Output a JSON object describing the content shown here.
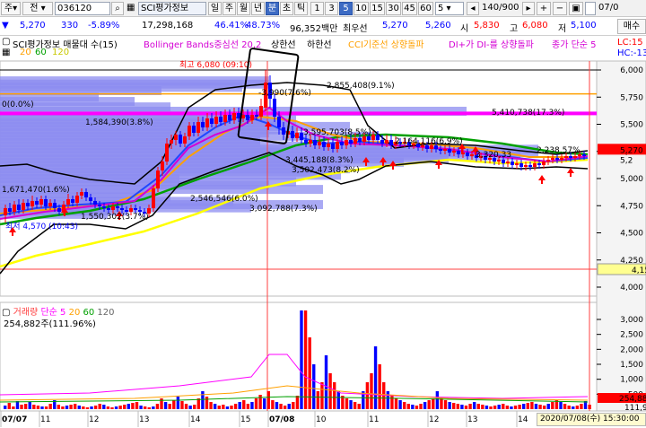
{
  "toolbar": {
    "menu_label": "주",
    "prev_label": "전",
    "stock_code": "036120",
    "stock_name": "SCI평가정보",
    "period_buttons": [
      "일",
      "주",
      "월",
      "년",
      "분",
      "초",
      "틱"
    ],
    "active_period": "분",
    "interval_buttons": [
      "1",
      "3",
      "5",
      "10",
      "15",
      "30",
      "45",
      "60"
    ],
    "active_interval": "5",
    "count_value": "5",
    "page_indicator": "140/900",
    "date_short": "07/0"
  },
  "price_info": {
    "price": "5,270",
    "change": "330",
    "change_rate": "-5.89%",
    "volume": "17,298,168",
    "rate_a": "46.41%",
    "rate_b": "48.73%",
    "trade_value": "96,352백만",
    "best_bid_label": "최우선",
    "ask": "5,270",
    "bid": "5,260",
    "open_label": "시",
    "open": "5,830",
    "high_label": "고",
    "high": "6,080",
    "low_label": "저",
    "low": "5,100"
  },
  "legend": {
    "main_series": "SCI평가정보 매물대 수(15)",
    "bollinger": "Bollinger Bands중심선 20,2",
    "upper_band": "상한선",
    "lower_band": "하한선",
    "cci": "CCI기준선 상향돌파",
    "dmi": "DI+가 DI-를 상향돌파",
    "close_ma": "종가 단순 5",
    "ma20": "20",
    "ma60": "60",
    "ma120": "120",
    "right_top": "LC:15",
    "right_bottom": "HC:-13"
  },
  "right_buttons": {
    "buy": "매수",
    "sell": "매도"
  },
  "price_axis": {
    "ticks": [
      "6,000",
      "5,750",
      "5,500",
      "5,250",
      "5,000",
      "4,750",
      "4,500",
      "4,250",
      "4,000"
    ],
    "current_price_tag": "5,270",
    "current_price_tag2": "5,2",
    "low_tag": "4,15"
  },
  "annotations": {
    "high": "최고 6,080 (09:10)",
    "low": "최저 4,570 (10:43)",
    "v1": "2,855,408(9.1%)",
    "v2": "-3,990(7.6%)",
    "v3": "5,410,738(17.3%)",
    "v4": "0(0.0%)",
    "v5": "1,584,390(3.8%)",
    "v6": "3,595,703(8.5%)",
    "v7": "2,164,116(6.9%)",
    "v8": "3,445,188(8.3%)",
    "v9": "3,502,473(8.2%)",
    "v10": "1,671,470(1.6%)",
    "v11": "2,546,546(6.0%)",
    "v12": "3,092,788(7.3%)",
    "v13": "1,550,302(3.7%)",
    "v14": "2,238,57%",
    "v15": "3,320,33"
  },
  "volume_panel": {
    "title": "거래량",
    "ma_label": "단순 5",
    "ma20": "20",
    "ma60": "60",
    "ma120": "120",
    "value": "254,882주(111.96%)",
    "ticks": [
      "3,000",
      "2,500",
      "2,000",
      "1,500",
      "1,000",
      "500"
    ],
    "tag_red": "254,88",
    "tag_black": "111,9"
  },
  "x_axis": {
    "labels": [
      "07/07",
      "11",
      "12",
      "13",
      "14",
      "15",
      "07/08",
      "10",
      "11",
      "12",
      "13",
      "14"
    ],
    "timestamp": "2020/07/08(수) 15:30:00"
  },
  "colors": {
    "up": "#ff0000",
    "down": "#0000ff",
    "bollinger_center": "#d400d4",
    "ma5": "#1f47ff",
    "ma20": "#ffa000",
    "ma60": "#00a000",
    "ma120": "#ffff00",
    "band": "#000000",
    "volume_profile": "#8c8cf0",
    "active_btn": "#3d6bc4"
  }
}
